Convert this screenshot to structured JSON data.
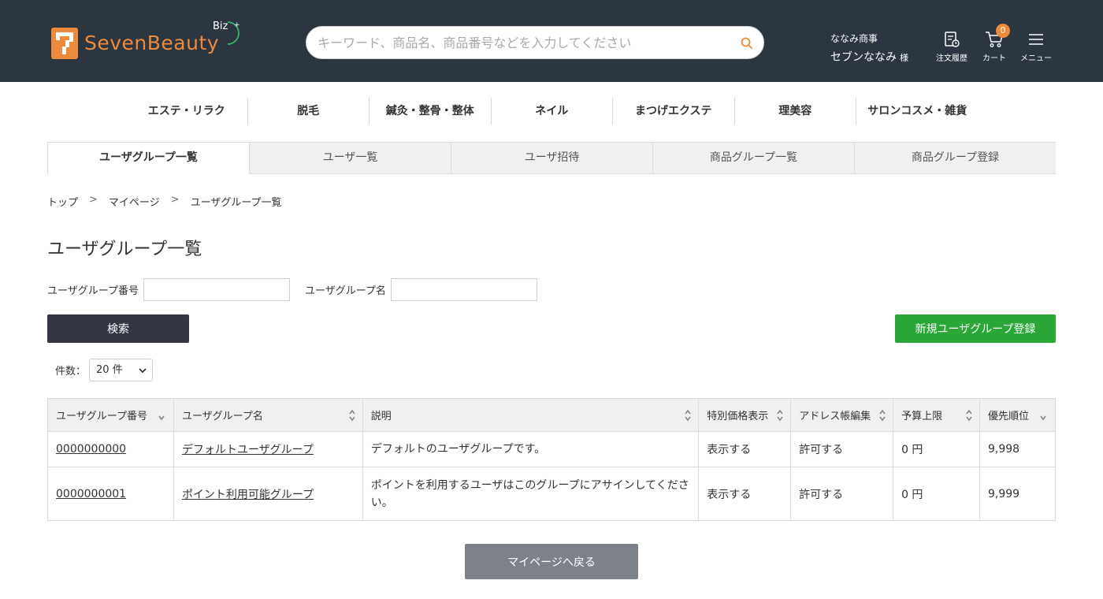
{
  "header": {
    "logo_text": "SevenBeauty",
    "logo_badge": "Biz",
    "search_placeholder": "キーワード、商品名、商品番号などを入力してください",
    "user_company": "ななみ商事",
    "user_name": "セブンななみ",
    "user_suffix": "様",
    "order_history_label": "注文履歴",
    "cart_label": "カート",
    "cart_count": "0",
    "menu_label": "メニュー",
    "brand_color": "#ee8a3c",
    "bg_color": "#2b3640"
  },
  "categories": [
    "エステ・リラク",
    "脱毛",
    "鍼灸・整骨・整体",
    "ネイル",
    "まつげエクステ",
    "理美容",
    "サロンコスメ・雑貨"
  ],
  "tabs": [
    {
      "label": "ユーザグループ一覧",
      "active": true
    },
    {
      "label": "ユーザ一覧",
      "active": false
    },
    {
      "label": "ユーザ招待",
      "active": false
    },
    {
      "label": "商品グループ一覧",
      "active": false
    },
    {
      "label": "商品グループ登録",
      "active": false
    }
  ],
  "breadcrumb": [
    "トップ",
    "マイページ",
    "ユーザグループ一覧"
  ],
  "page_title": "ユーザグループ一覧",
  "form": {
    "group_number_label": "ユーザグループ番号",
    "group_number_value": "",
    "group_name_label": "ユーザグループ名",
    "group_name_value": "",
    "search_button": "検索",
    "new_button": "新規ユーザグループ登録",
    "count_label": "件数：",
    "count_value": "20 件"
  },
  "table": {
    "columns": [
      "ユーザグループ番号",
      "ユーザグループ名",
      "説明",
      "特別価格表示",
      "アドレス帳編集",
      "予算上限",
      "優先順位"
    ],
    "rows": [
      [
        "0000000000",
        "デフォルトユーザグループ",
        "デフォルトのユーザグループです。",
        "表示する",
        "許可する",
        "0 円",
        "9,998"
      ],
      [
        "0000000001",
        "ポイント利用可能グループ",
        "ポイントを利用するユーザはこのグループにアサインしてください。",
        "表示する",
        "許可する",
        "0 円",
        "9,999"
      ]
    ]
  },
  "back_button": "マイページへ戻る"
}
